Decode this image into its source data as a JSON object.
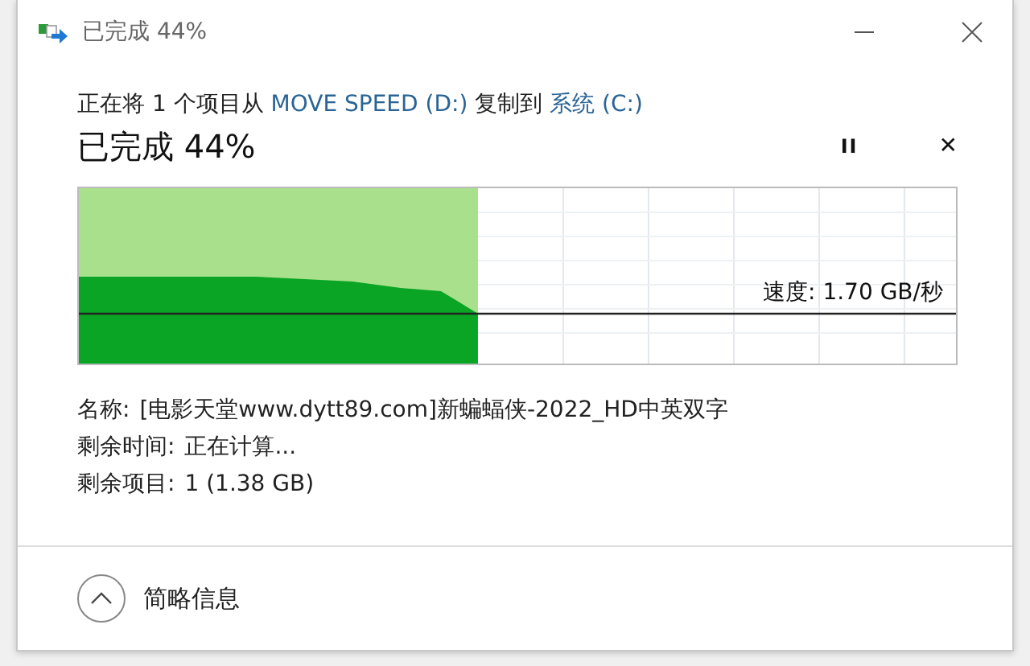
{
  "window": {
    "title": "已完成 44%"
  },
  "header": {
    "parts": [
      {
        "kind": "text",
        "text": "正在将 1 个项目从 "
      },
      {
        "kind": "link",
        "text": "MOVE SPEED (D:)"
      },
      {
        "kind": "text",
        "text": " 复制到 "
      },
      {
        "kind": "link",
        "text": "系统 (C:)"
      }
    ]
  },
  "status": {
    "title": "已完成 44%",
    "buttons": [
      {
        "kind": "pause",
        "label": "II"
      },
      {
        "kind": "cancel",
        "label": "✕"
      }
    ]
  },
  "progress": {
    "level": 0.455,
    "speed": "速度: 1.70 GB/秒"
  },
  "details": [
    {
      "label": "名称:",
      "value": "[电影天堂www.dytt89.com]新蝙蝠侠-2022_HD中英双字"
    },
    {
      "label": "剩余时间:",
      "value": "正在计算..."
    },
    {
      "label": "剩余项目:",
      "value": "1 (1.38 GB)"
    }
  ],
  "footer": {
    "toggle": "简略信息"
  }
}
